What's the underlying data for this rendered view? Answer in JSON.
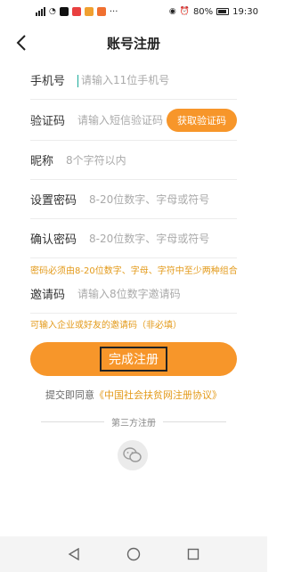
{
  "status_bar": {
    "battery": "80%",
    "time": "19:30"
  },
  "header": {
    "title": "账号注册"
  },
  "form": {
    "phone": {
      "label": "手机号",
      "placeholder": "请输入11位手机号"
    },
    "code": {
      "label": "验证码",
      "placeholder": "请输入短信验证码",
      "button": "获取验证码"
    },
    "nickname": {
      "label": "昵称",
      "placeholder": "8个字符以内"
    },
    "password": {
      "label": "设置密码",
      "placeholder": "8-20位数字、字母或符号"
    },
    "confirm": {
      "label": "确认密码",
      "placeholder": "8-20位数字、字母或符号"
    },
    "password_hint": "密码必须由8-20位数字、字母、字符中至少两种组合",
    "invite": {
      "label": "邀请码",
      "placeholder": "请输入8位数字邀请码"
    },
    "invite_hint": "可输入企业或好友的邀请码（非必填）"
  },
  "submit": {
    "label": "完成注册"
  },
  "agreement": {
    "prefix": "提交即同意",
    "link": "《中国社会扶贫网注册协议》"
  },
  "third_party": {
    "label": "第三方注册"
  },
  "colors": {
    "accent": "#f7962a",
    "hint": "#e39a1a"
  },
  "icons": {
    "back": "back-chevron-icon",
    "wechat": "wechat-icon",
    "nav_back": "triangle-back-icon",
    "nav_home": "circle-home-icon",
    "nav_recent": "square-recent-icon"
  }
}
